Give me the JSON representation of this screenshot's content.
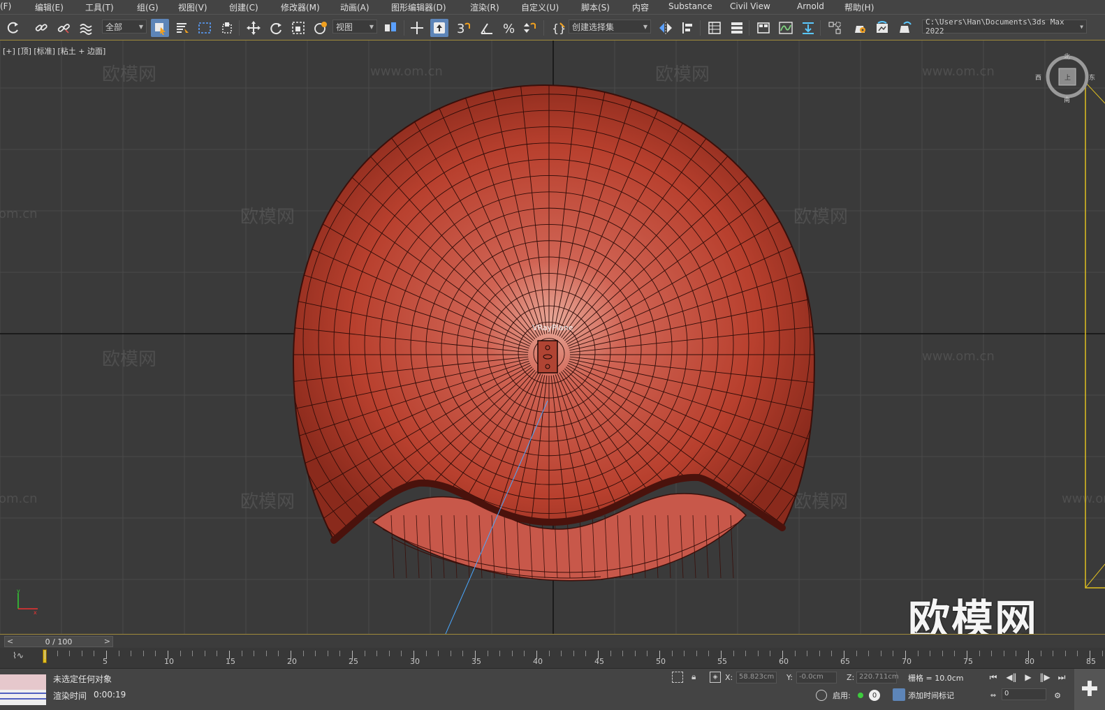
{
  "menu": [
    "(F)",
    "编辑(E)",
    "工具(T)",
    "组(G)",
    "视图(V)",
    "创建(C)",
    "修改器(M)",
    "动画(A)",
    "图形编辑器(D)",
    "渲染(R)",
    "自定义(U)",
    "脚本(S)",
    "内容",
    "Substance",
    "Civil View",
    "Arnold",
    "帮助(H)"
  ],
  "toolbar": {
    "selection_filter": "全部",
    "ref_coord": "视图",
    "named_selection": "创建选择集",
    "project_path": "C:\\Users\\Han\\Documents\\3ds Max 2022"
  },
  "viewport": {
    "label": "[+] [顶] [标准] [粘土 + 边面]",
    "object_label": "VRayPlane",
    "watermark_cn": "欧模网",
    "watermark_url": "www.om.cn",
    "watermark_partial": "om.cn",
    "logo": "欧模网",
    "viewcube": {
      "face": "上",
      "north": "北",
      "south": "南",
      "west": "西",
      "east": "东"
    },
    "axis_y": "y",
    "axis_x": "x"
  },
  "timeslider": {
    "frame_display": "0 / 100",
    "prev": "<",
    "next": ">"
  },
  "trackbar": {
    "ticks": [
      "5",
      "10",
      "15",
      "20",
      "25",
      "30",
      "35",
      "40",
      "45",
      "50",
      "55",
      "60",
      "65",
      "70",
      "75",
      "80",
      "85"
    ]
  },
  "status": {
    "selection": "未选定任何对象",
    "render_time_label": "渲染时间",
    "render_time": "0:00:19",
    "x_label": "X:",
    "x_value": "58.823cm",
    "y_label": "Y:",
    "y_value": "-0.0cm",
    "z_label": "Z:",
    "z_value": "220.711cm",
    "grid": "栅格 = 10.0cm",
    "enable_label": "启用:",
    "enable_count": "0",
    "add_time_tag": "添加时间标记",
    "frame_field": "0"
  },
  "colors": {
    "viewport_bg": "#3a3a3a",
    "mesh": "#c04a3a",
    "accent": "#5d85b8",
    "gold_border": "#a08a3a"
  }
}
